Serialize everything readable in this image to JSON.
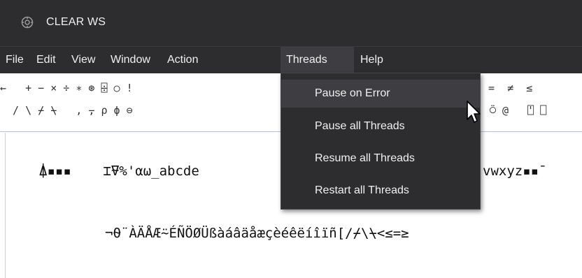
{
  "window": {
    "title": "CLEAR WS",
    "icon": "gear-logo-icon"
  },
  "menubar": {
    "items": [
      {
        "label": "File"
      },
      {
        "label": "Edit"
      },
      {
        "label": "View"
      },
      {
        "label": "Window"
      },
      {
        "label": "Action"
      },
      {
        "label": "Threads",
        "open": true
      },
      {
        "label": "Help"
      }
    ]
  },
  "threads_menu": {
    "items": [
      {
        "label": "Pause on Error",
        "highlighted": true
      },
      {
        "label": "Pause all Threads"
      },
      {
        "label": "Resume all Threads"
      },
      {
        "label": "Restart all Threads"
      }
    ]
  },
  "toolbar": {
    "row1_left": "←   + − × ÷ ∗ ⊛ ⌹ ○ !",
    "row1_right": "=  ≠  ≤",
    "row2_left": "  / \\ ⌿ ⍀   , ⍪ ρ ϕ ⊖",
    "row2_right": "⍥ @   ⍞ ⎕"
  },
  "editor": {
    "line1_left": "⍋▪▪▪    ⌶⍫%'⍺⍵_abcde",
    "line1_right": "vwxyz▪▪¯",
    "line2": "¬⍬¨ÀÄÅÆ⍨ÉÑÖØÜßàáâäåæçèéêëíîïñ[/⌿\\⍀<≤=≥"
  },
  "colors": {
    "titlebar_bg": "#2d2d30",
    "menu_fg": "#f0f0f0",
    "menu_open_bg": "#3e3e42",
    "dropdown_bg": "#2d2d30",
    "dropdown_highlight": "#3e3e42",
    "editor_bg": "#ffffff"
  }
}
